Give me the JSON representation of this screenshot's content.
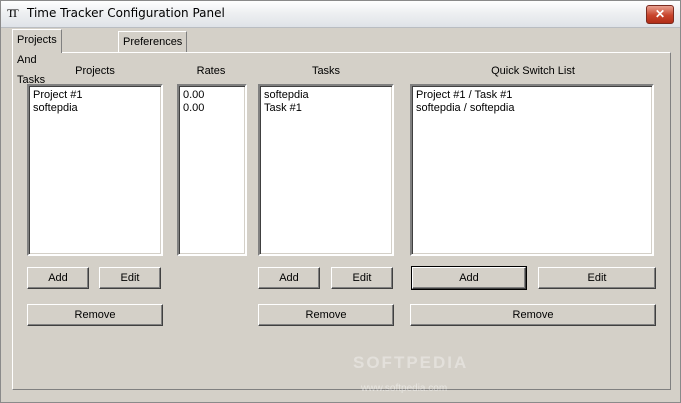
{
  "window": {
    "title": "Time Tracker Configuration Panel",
    "icon_text": "TT",
    "close_glyph": "✕"
  },
  "tabs": [
    {
      "label": "Projects And Tasks",
      "active": true
    },
    {
      "label": "Preferences",
      "active": false
    }
  ],
  "projects": {
    "label": "Projects",
    "items": [
      "Project #1",
      "softepdia"
    ],
    "add": "Add",
    "edit": "Edit",
    "remove": "Remove"
  },
  "rates": {
    "label": "Rates",
    "items": [
      "0.00",
      "0.00"
    ]
  },
  "tasks": {
    "label": "Tasks",
    "items": [
      "softepdia",
      "Task #1"
    ],
    "add": "Add",
    "edit": "Edit",
    "remove": "Remove"
  },
  "quick_switch": {
    "label": "Quick Switch List",
    "items": [
      "Project #1 / Task #1",
      "softepdia / softepdia"
    ],
    "add": "Add",
    "edit": "Edit",
    "remove": "Remove"
  },
  "watermark": {
    "text": "SOFTPEDIA",
    "url": "www.softpedia.com"
  }
}
